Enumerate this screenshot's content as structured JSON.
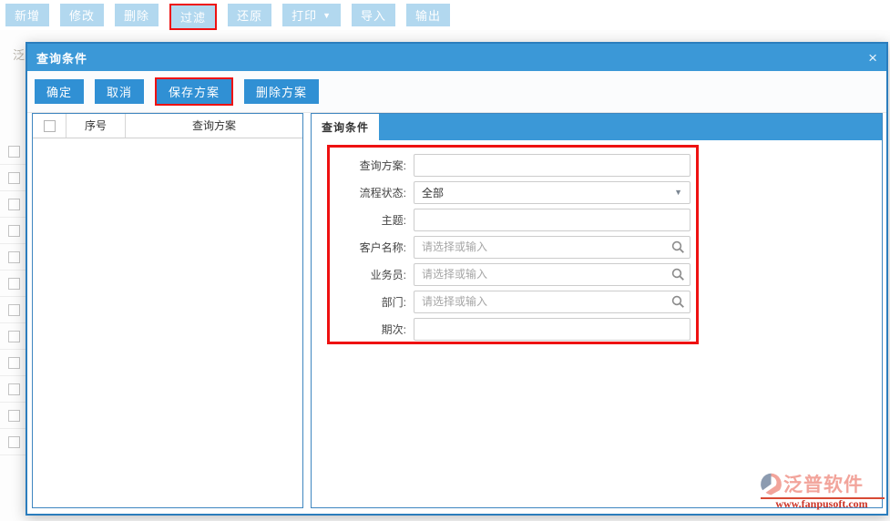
{
  "toolbar": {
    "buttons": [
      {
        "label": "新增",
        "highlighted": false
      },
      {
        "label": "修改",
        "highlighted": false
      },
      {
        "label": "删除",
        "highlighted": false
      },
      {
        "label": "过滤",
        "highlighted": true
      },
      {
        "label": "还原",
        "highlighted": false
      },
      {
        "label": "打印",
        "has_dropdown": true,
        "dropdown_icon": "▼",
        "highlighted": false
      },
      {
        "label": "导入",
        "highlighted": false
      },
      {
        "label": "输出",
        "highlighted": false
      }
    ]
  },
  "background": {
    "fragment_text": "泛"
  },
  "modal": {
    "title": "查询条件",
    "close_icon": "×",
    "actions": [
      {
        "label": "确定",
        "highlighted": false
      },
      {
        "label": "取消",
        "highlighted": false
      },
      {
        "label": "保存方案",
        "highlighted": true
      },
      {
        "label": "删除方案",
        "highlighted": false
      }
    ],
    "plan_table": {
      "columns": {
        "index": "序号",
        "plan": "查询方案"
      },
      "rows": []
    },
    "tab": {
      "label": "查询条件"
    },
    "form": {
      "fields": [
        {
          "label": "查询方案:",
          "type": "text",
          "value": ""
        },
        {
          "label": "流程状态:",
          "type": "select",
          "value": "全部",
          "caret": "▼"
        },
        {
          "label": "主题:",
          "type": "text",
          "value": ""
        },
        {
          "label": "客户名称:",
          "type": "search",
          "placeholder": "请选择或输入"
        },
        {
          "label": "业务员:",
          "type": "search",
          "placeholder": "请选择或输入"
        },
        {
          "label": "部门:",
          "type": "search",
          "placeholder": "请选择或输入"
        },
        {
          "label": "期次:",
          "type": "text",
          "value": ""
        }
      ]
    }
  },
  "watermark": {
    "brand": "泛普软件",
    "url": "www.fanpusoft.com"
  },
  "colors": {
    "accent_blue": "#3b98d7",
    "button_light_blue": "#b2d8ef",
    "panel_border_blue": "#3e86c0",
    "highlight_red": "#ee1111",
    "watermark_coral": "#f2a49b",
    "watermark_red": "#cc3326"
  }
}
